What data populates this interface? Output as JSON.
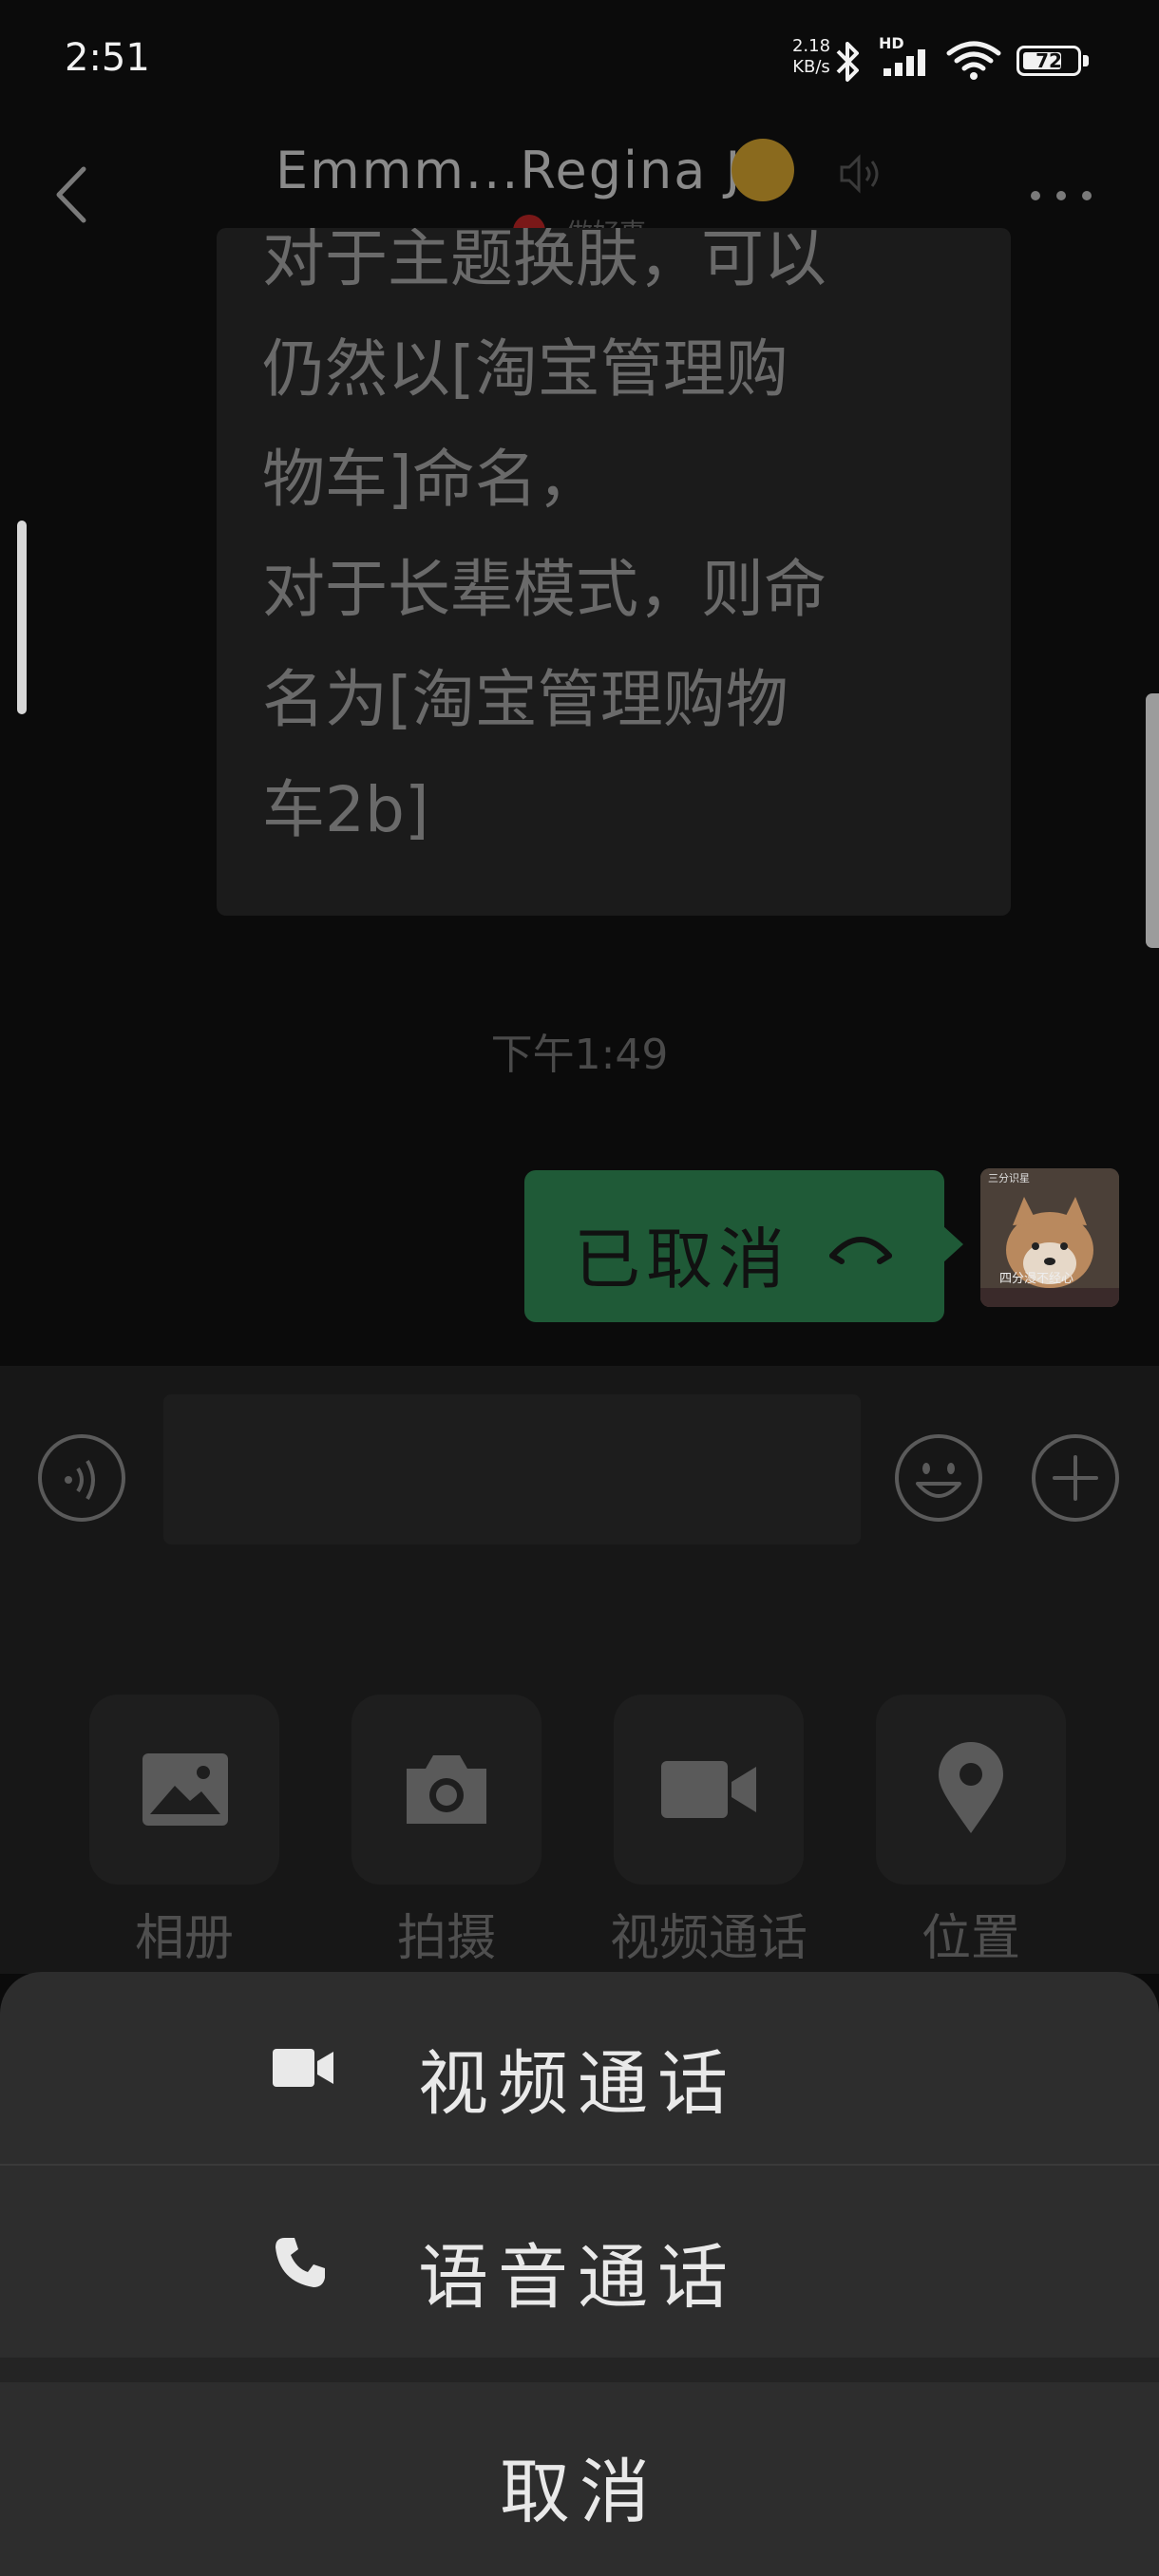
{
  "status_bar": {
    "time": "2:51",
    "net_speed_value": "2.18",
    "net_speed_unit": "KB/s",
    "hd_label": "HD",
    "battery_level": "72",
    "battery_fraction": 0.72
  },
  "header": {
    "title": "Emmm...Regina J",
    "title_emoji": "raised-eyebrow-emoji",
    "subtitle": "做好事",
    "back_icon": "chevron-left-icon",
    "speaker_icon": "speaker-icon",
    "more_icon": "more-dots-icon"
  },
  "chat": {
    "incoming_text": "对于主题换肤，可以\n仍然以[淘宝管理购\n物车]命名，\n对于长辈模式，则命\n名为[淘宝管理购物\n车2b]",
    "timestamp": "下午1:49",
    "outgoing_text": "已取消",
    "outgoing_icon": "cancelled-call-icon",
    "avatar_caption_top": "三分识星",
    "avatar_caption_bottom": "四分漫不经心"
  },
  "input_bar": {
    "voice_icon": "voice-toggle-icon",
    "emoji_icon": "emoji-icon",
    "plus_icon": "plus-icon"
  },
  "tools": [
    {
      "label": "相册",
      "icon": "photo-album-icon"
    },
    {
      "label": "拍摄",
      "icon": "camera-icon"
    },
    {
      "label": "视频通话",
      "icon": "video-call-icon"
    },
    {
      "label": "位置",
      "icon": "location-icon"
    }
  ],
  "action_sheet": {
    "video_call_label": "视频通话",
    "voice_call_label": "语音通话",
    "cancel_label": "取消"
  },
  "colors": {
    "outgoing_bubble": "#1f5a37",
    "sheet_background": "#2d2d2d",
    "page_background": "#0b0b0b"
  }
}
